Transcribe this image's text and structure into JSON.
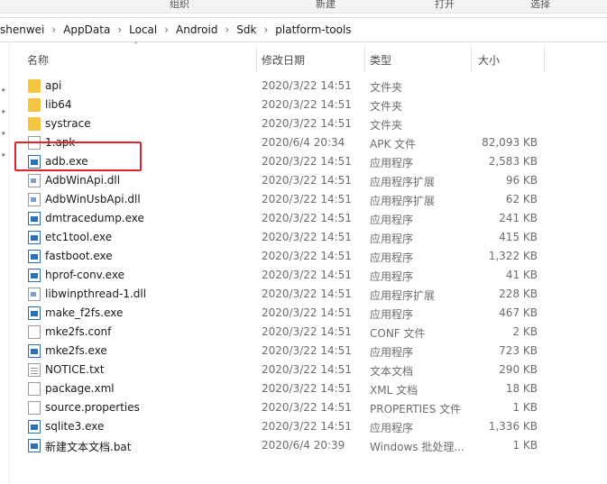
{
  "ribbon": {
    "organize": "组织",
    "new": "新建",
    "open": "打开",
    "select": "选择"
  },
  "breadcrumb": [
    "shenwei",
    "AppData",
    "Local",
    "Android",
    "Sdk",
    "platform-tools"
  ],
  "columns": {
    "name": "名称",
    "date": "修改日期",
    "type": "类型",
    "size": "大小"
  },
  "files": [
    {
      "name": "api",
      "date": "2020/3/22 14:51",
      "type": "文件夹",
      "size": "",
      "icon": "folder-icon"
    },
    {
      "name": "lib64",
      "date": "2020/3/22 14:51",
      "type": "文件夹",
      "size": "",
      "icon": "folder-icon"
    },
    {
      "name": "systrace",
      "date": "2020/3/22 14:51",
      "type": "文件夹",
      "size": "",
      "icon": "folder-icon"
    },
    {
      "name": "1.apk",
      "date": "2020/6/4 20:34",
      "type": "APK 文件",
      "size": "82,093 KB",
      "icon": "file-icon"
    },
    {
      "name": "adb.exe",
      "date": "2020/3/22 14:51",
      "type": "应用程序",
      "size": "2,583 KB",
      "icon": "exe-icon"
    },
    {
      "name": "AdbWinApi.dll",
      "date": "2020/3/22 14:51",
      "type": "应用程序扩展",
      "size": "96 KB",
      "icon": "dll-icon"
    },
    {
      "name": "AdbWinUsbApi.dll",
      "date": "2020/3/22 14:51",
      "type": "应用程序扩展",
      "size": "62 KB",
      "icon": "dll-icon"
    },
    {
      "name": "dmtracedump.exe",
      "date": "2020/3/22 14:51",
      "type": "应用程序",
      "size": "241 KB",
      "icon": "exe-icon"
    },
    {
      "name": "etc1tool.exe",
      "date": "2020/3/22 14:51",
      "type": "应用程序",
      "size": "415 KB",
      "icon": "exe-icon"
    },
    {
      "name": "fastboot.exe",
      "date": "2020/3/22 14:51",
      "type": "应用程序",
      "size": "1,322 KB",
      "icon": "exe-icon"
    },
    {
      "name": "hprof-conv.exe",
      "date": "2020/3/22 14:51",
      "type": "应用程序",
      "size": "41 KB",
      "icon": "exe-icon"
    },
    {
      "name": "libwinpthread-1.dll",
      "date": "2020/3/22 14:51",
      "type": "应用程序扩展",
      "size": "228 KB",
      "icon": "dll-icon"
    },
    {
      "name": "make_f2fs.exe",
      "date": "2020/3/22 14:51",
      "type": "应用程序",
      "size": "467 KB",
      "icon": "exe-icon"
    },
    {
      "name": "mke2fs.conf",
      "date": "2020/3/22 14:51",
      "type": "CONF 文件",
      "size": "2 KB",
      "icon": "file-icon"
    },
    {
      "name": "mke2fs.exe",
      "date": "2020/3/22 14:51",
      "type": "应用程序",
      "size": "723 KB",
      "icon": "exe-icon"
    },
    {
      "name": "NOTICE.txt",
      "date": "2020/3/22 14:51",
      "type": "文本文档",
      "size": "290 KB",
      "icon": "text-file-icon"
    },
    {
      "name": "package.xml",
      "date": "2020/3/22 14:51",
      "type": "XML 文档",
      "size": "18 KB",
      "icon": "xml-file-icon"
    },
    {
      "name": "source.properties",
      "date": "2020/3/22 14:51",
      "type": "PROPERTIES 文件",
      "size": "1 KB",
      "icon": "file-icon"
    },
    {
      "name": "sqlite3.exe",
      "date": "2020/3/22 14:51",
      "type": "应用程序",
      "size": "1,336 KB",
      "icon": "exe-icon"
    },
    {
      "name": "新建文本文档.bat",
      "date": "2020/6/4 20:39",
      "type": "Windows 批处理...",
      "size": "1 KB",
      "icon": "bat-file-icon"
    }
  ],
  "colors": {
    "highlight": "#e1232d",
    "folder": "#f5c542",
    "exe_accent": "#2a6fb8"
  }
}
